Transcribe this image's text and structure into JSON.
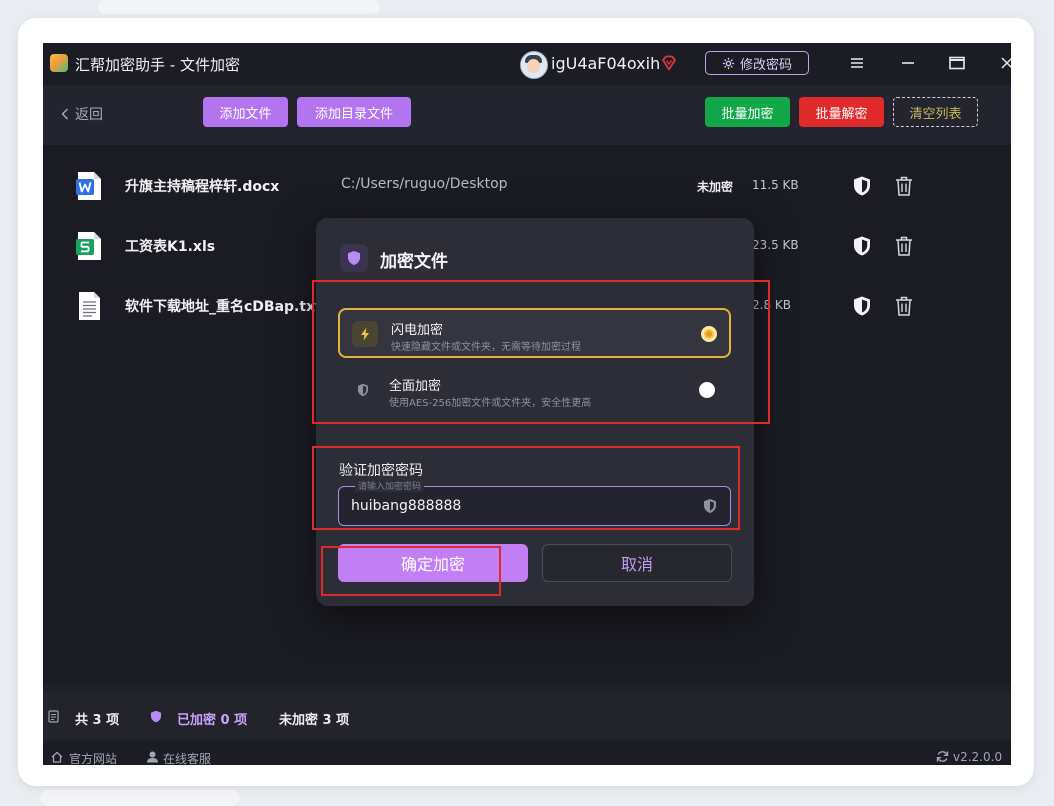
{
  "window": {
    "title": "汇帮加密助手 - 文件加密",
    "username": "igU4aF04oxih",
    "change_password_label": "修改密码"
  },
  "toolbar": {
    "back_label": "返回",
    "add_file_label": "添加文件",
    "add_dir_label": "添加目录文件",
    "batch_encrypt_label": "批量加密",
    "batch_decrypt_label": "批量解密",
    "clear_list_label": "清空列表"
  },
  "files": [
    {
      "name": "升旗主持稿程梓轩.docx",
      "path": "C:/Users/ruguo/Desktop",
      "status": "未加密",
      "size": "11.5 KB",
      "icon": "word-file-icon"
    },
    {
      "name": "工资表K1.xls",
      "path": "",
      "status": "",
      "size": "23.5 KB",
      "icon": "spreadsheet-file-icon"
    },
    {
      "name": "软件下载地址_重名cDBap.txt",
      "path": "",
      "status": "",
      "size": "2.8 KB",
      "icon": "text-file-icon"
    }
  ],
  "dialog": {
    "title": "加密文件",
    "options": [
      {
        "title": "闪电加密",
        "desc": "快速隐藏文件或文件夹，无需等待加密过程",
        "selected": true,
        "icon": "lightning-icon"
      },
      {
        "title": "全面加密",
        "desc": "使用AES-256加密文件或文件夹，安全性更高",
        "selected": false,
        "icon": "shield-icon"
      }
    ],
    "password_label": "验证加密密码",
    "password_placeholder": "请输入加密密码",
    "password_value": "huibang888888",
    "confirm_label": "确定加密",
    "cancel_label": "取消"
  },
  "status": {
    "total": "共 3 项",
    "encrypted": "已加密 0 项",
    "unencrypted": "未加密 3 项"
  },
  "footer": {
    "website": "官方网站",
    "support": "在线客服",
    "version": "v2.2.0.0"
  },
  "colors": {
    "accent_purple": "#b374ef",
    "green": "#12a84a",
    "red": "#e12a2c",
    "selected_gold": "#e3b43b",
    "annotation_red": "#e02a2a"
  }
}
